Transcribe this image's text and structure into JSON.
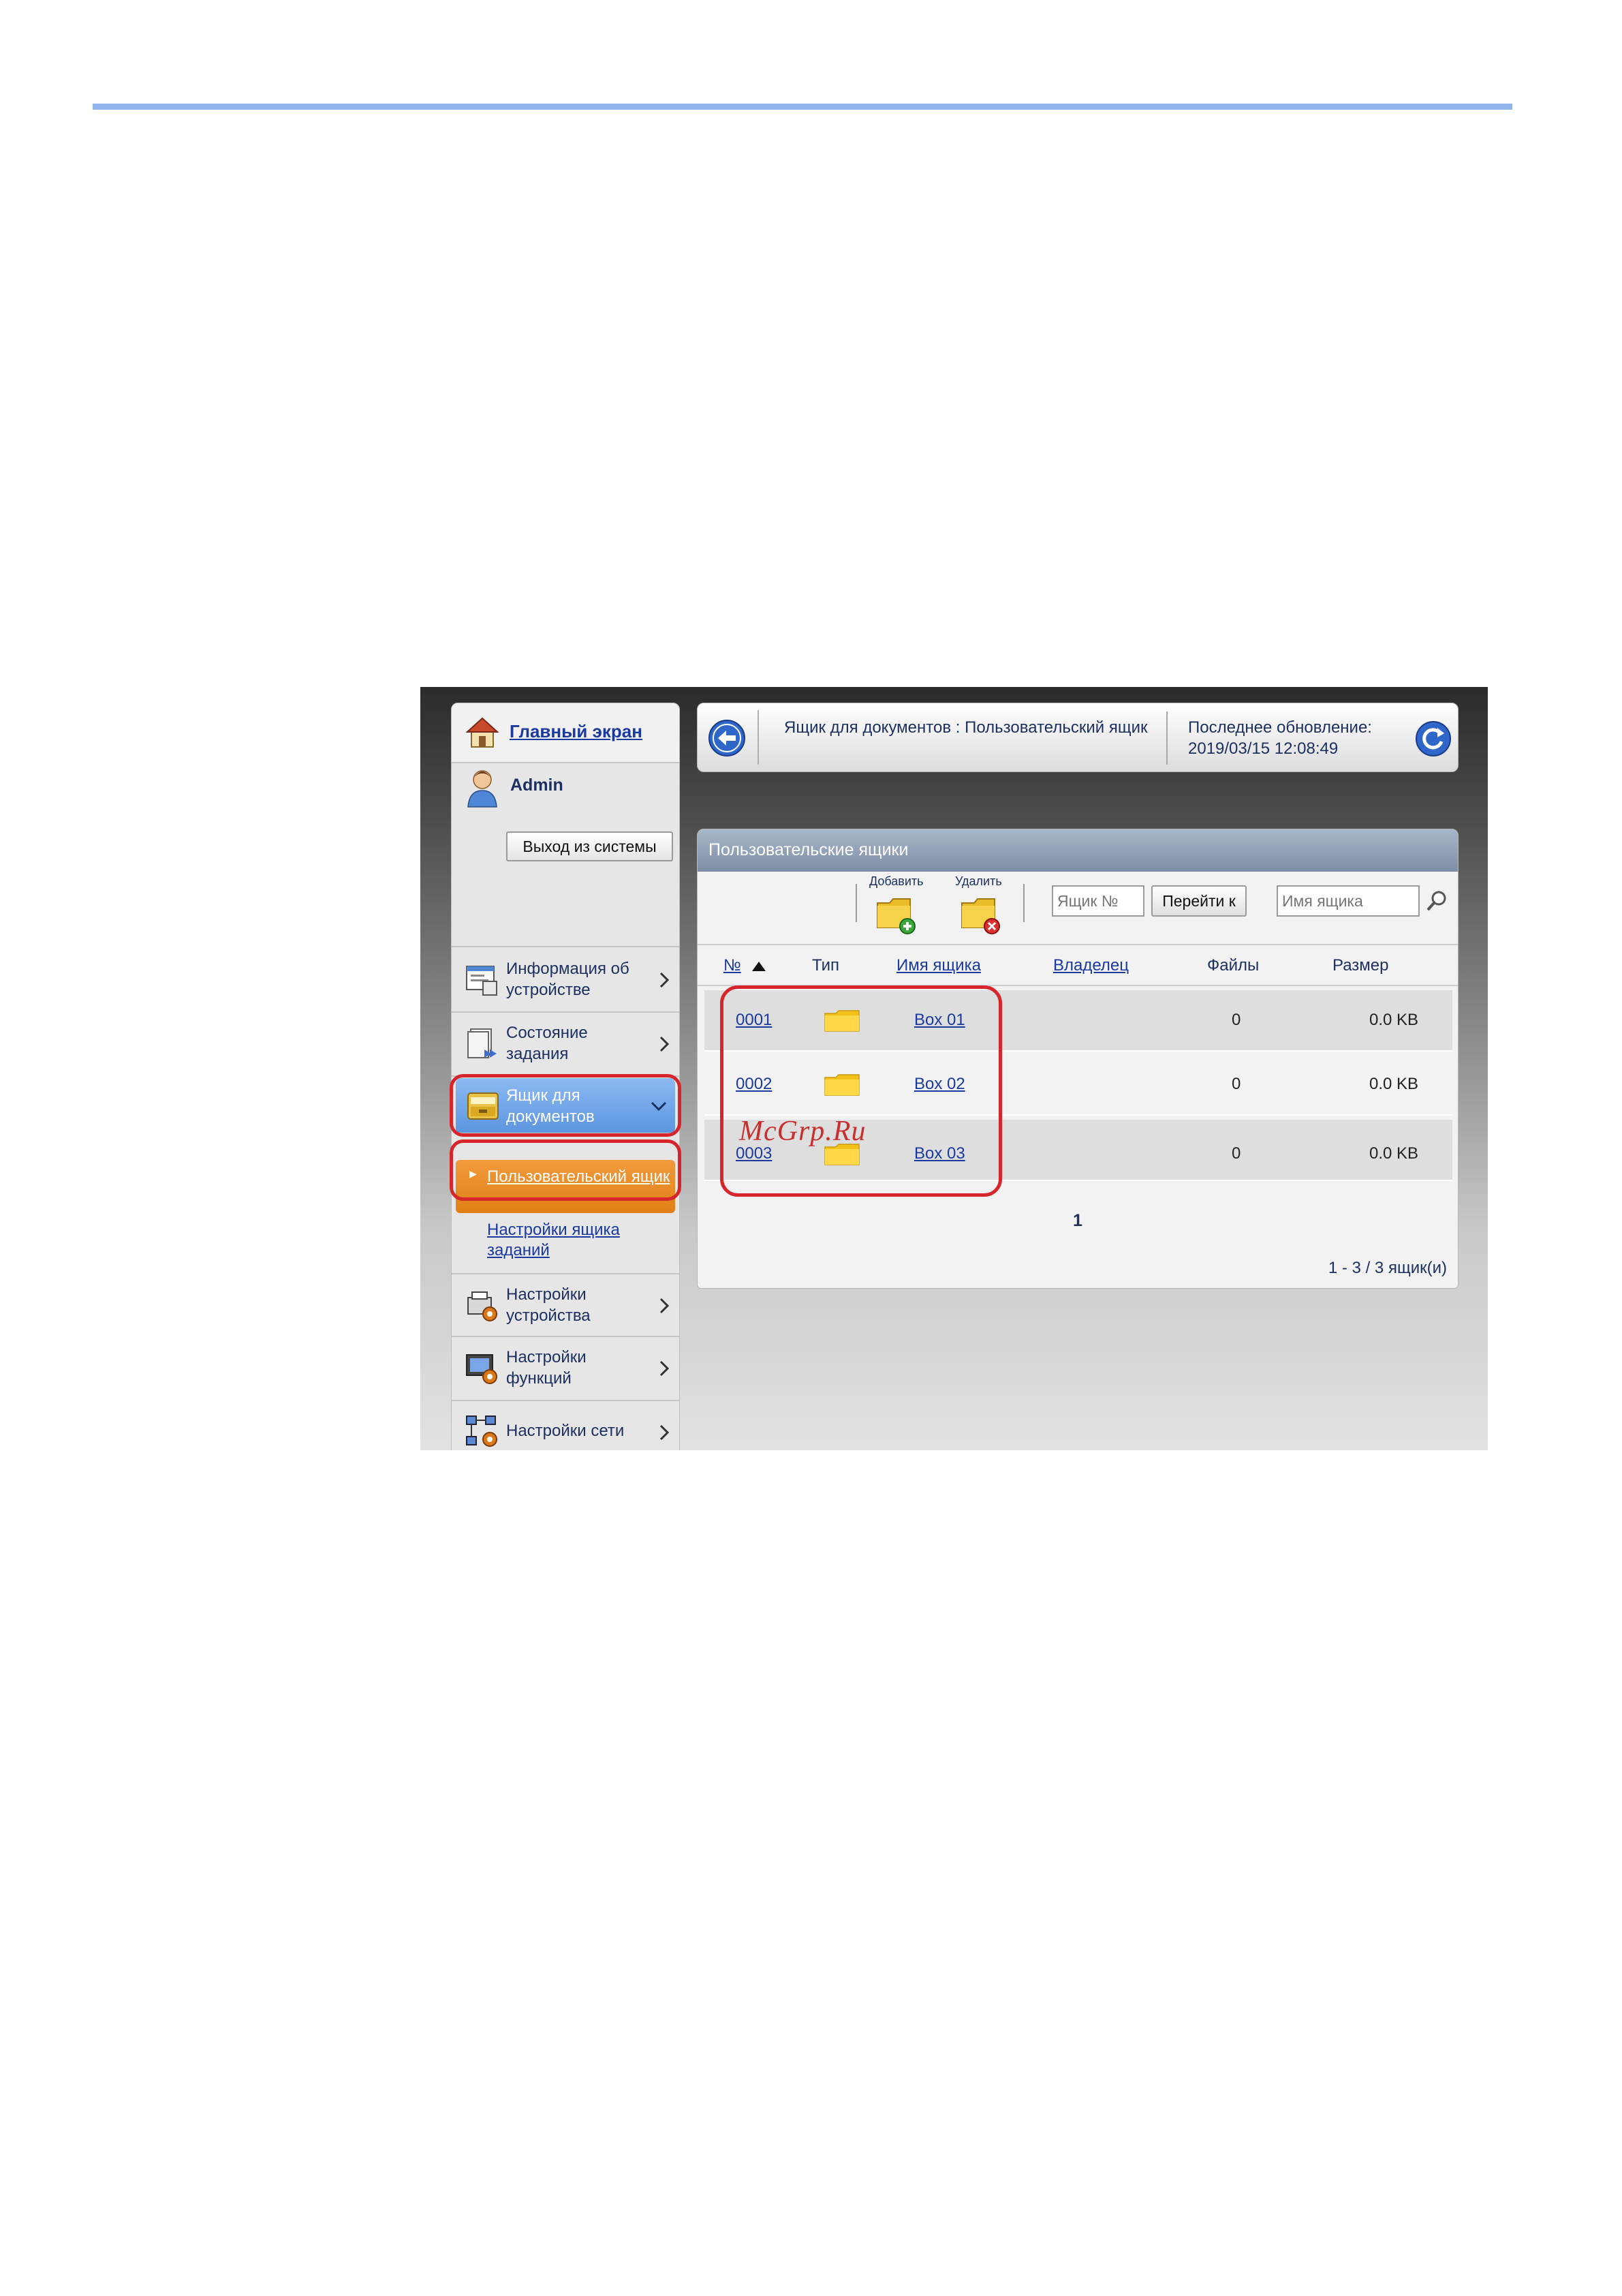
{
  "sidebar": {
    "home_label": "Главный экран",
    "user_name": "Admin",
    "logout_label": "Выход из системы",
    "items": [
      {
        "label": "Информация об устройстве",
        "icon": "device-info-icon"
      },
      {
        "label": "Состояние задания",
        "icon": "job-status-icon"
      },
      {
        "label": "Ящик для документов",
        "icon": "document-box-icon"
      },
      {
        "label": "Настройки устройства",
        "icon": "device-settings-icon"
      },
      {
        "label": "Настройки функций",
        "icon": "function-settings-icon"
      },
      {
        "label": "Настройки сети",
        "icon": "network-settings-icon"
      }
    ],
    "subitems": [
      {
        "label": "Пользовательский ящик"
      },
      {
        "label": "Настройки ящика заданий"
      }
    ]
  },
  "header": {
    "breadcrumb": "Ящик для документов : Пользовательский ящик",
    "last_update_label": "Последнее обновление:",
    "last_update_value": "2019/03/15 12:08:49"
  },
  "panel": {
    "title": "Пользовательские ящики",
    "toolbar": {
      "add_label": "Добавить",
      "delete_label": "Удалить",
      "box_no_placeholder": "Ящик №",
      "goto_label": "Перейти к",
      "box_name_placeholder": "Имя ящика"
    },
    "columns": [
      "№",
      "Тип",
      "Имя ящика",
      "Владелец",
      "Файлы",
      "Размер"
    ],
    "rows": [
      {
        "no": "0001",
        "name": "Box 01",
        "owner": "",
        "files": "0",
        "size": "0.0 KB"
      },
      {
        "no": "0002",
        "name": "Box 02",
        "owner": "",
        "files": "0",
        "size": "0.0 KB"
      },
      {
        "no": "0003",
        "name": "Box 03",
        "owner": "",
        "files": "0",
        "size": "0.0 KB"
      }
    ],
    "page": "1",
    "count": "1 - 3 / 3 ящик(и)"
  },
  "watermark": "McGrp.Ru",
  "colors": {
    "rule": "#8fb4ee",
    "highlight": "#d6262b",
    "active_nav": "#5c95e0",
    "active_sub": "#e07f16",
    "link": "#1a3aa0"
  }
}
